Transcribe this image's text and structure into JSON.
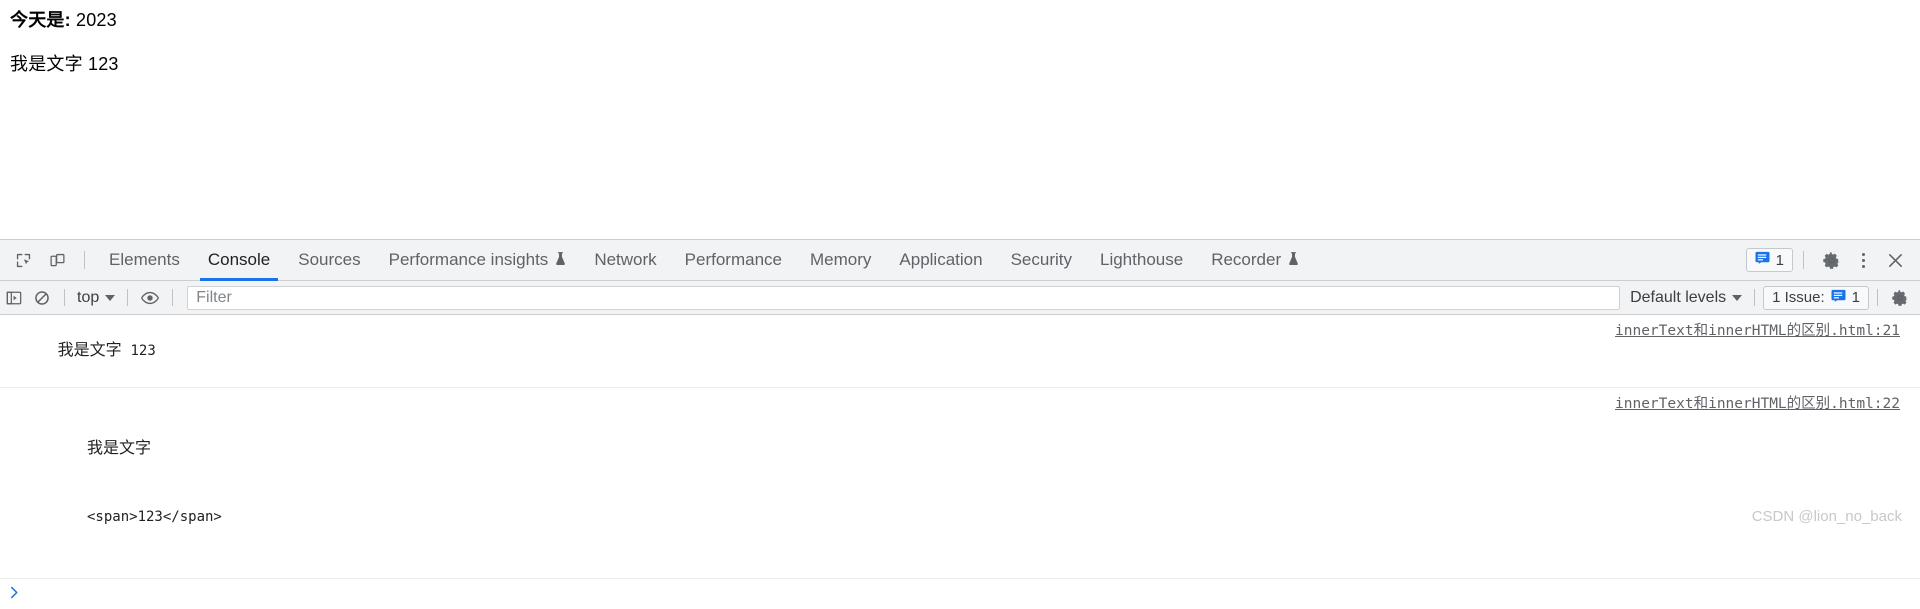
{
  "page": {
    "line1_label": "今天是:",
    "line1_value": "2023",
    "line2": "我是文字 123"
  },
  "devtools": {
    "toolbar_icons": {
      "inspect": "inspect-element-icon",
      "device": "device-toolbar-icon"
    },
    "tabs": [
      {
        "label": "Elements",
        "selected": false,
        "experimental": false
      },
      {
        "label": "Console",
        "selected": true,
        "experimental": false
      },
      {
        "label": "Sources",
        "selected": false,
        "experimental": false
      },
      {
        "label": "Performance insights",
        "selected": false,
        "experimental": true
      },
      {
        "label": "Network",
        "selected": false,
        "experimental": false
      },
      {
        "label": "Performance",
        "selected": false,
        "experimental": false
      },
      {
        "label": "Memory",
        "selected": false,
        "experimental": false
      },
      {
        "label": "Application",
        "selected": false,
        "experimental": false
      },
      {
        "label": "Security",
        "selected": false,
        "experimental": false
      },
      {
        "label": "Lighthouse",
        "selected": false,
        "experimental": false
      },
      {
        "label": "Recorder",
        "selected": false,
        "experimental": true
      }
    ],
    "flask_glyph": "⚗",
    "issues_badge_count": "1",
    "settings_icon": "gear-icon",
    "more_icon": "kebab-menu-icon",
    "close_icon": "close-icon",
    "console_toolbar": {
      "sidebar_icon": "console-sidebar-icon",
      "clear_icon": "clear-console-icon",
      "context_label": "top",
      "eye_icon": "live-expressions-eye-icon",
      "filter_placeholder": "Filter",
      "filter_value": "",
      "levels_label": "Default levels",
      "issues_label": "1 Issue:",
      "issues_count": "1",
      "settings_icon": "console-settings-gear-icon"
    }
  },
  "console": {
    "entries": [
      {
        "text_cn": "我是文字",
        "text_code": "123",
        "source": "innerText和innerHTML的区别.html:21"
      },
      {
        "line1": "我是文字",
        "line2": "<span>123</span>",
        "source": "innerText和innerHTML的区别.html:22"
      }
    ],
    "prompt_glyph": "❯"
  },
  "watermark": "CSDN @lion_no_back",
  "colors": {
    "accent_blue": "#1a73e8",
    "toolbar_bg": "#f1f3f4",
    "border": "#cdcdcd",
    "text": "#202124",
    "muted_text": "#5f6368"
  }
}
